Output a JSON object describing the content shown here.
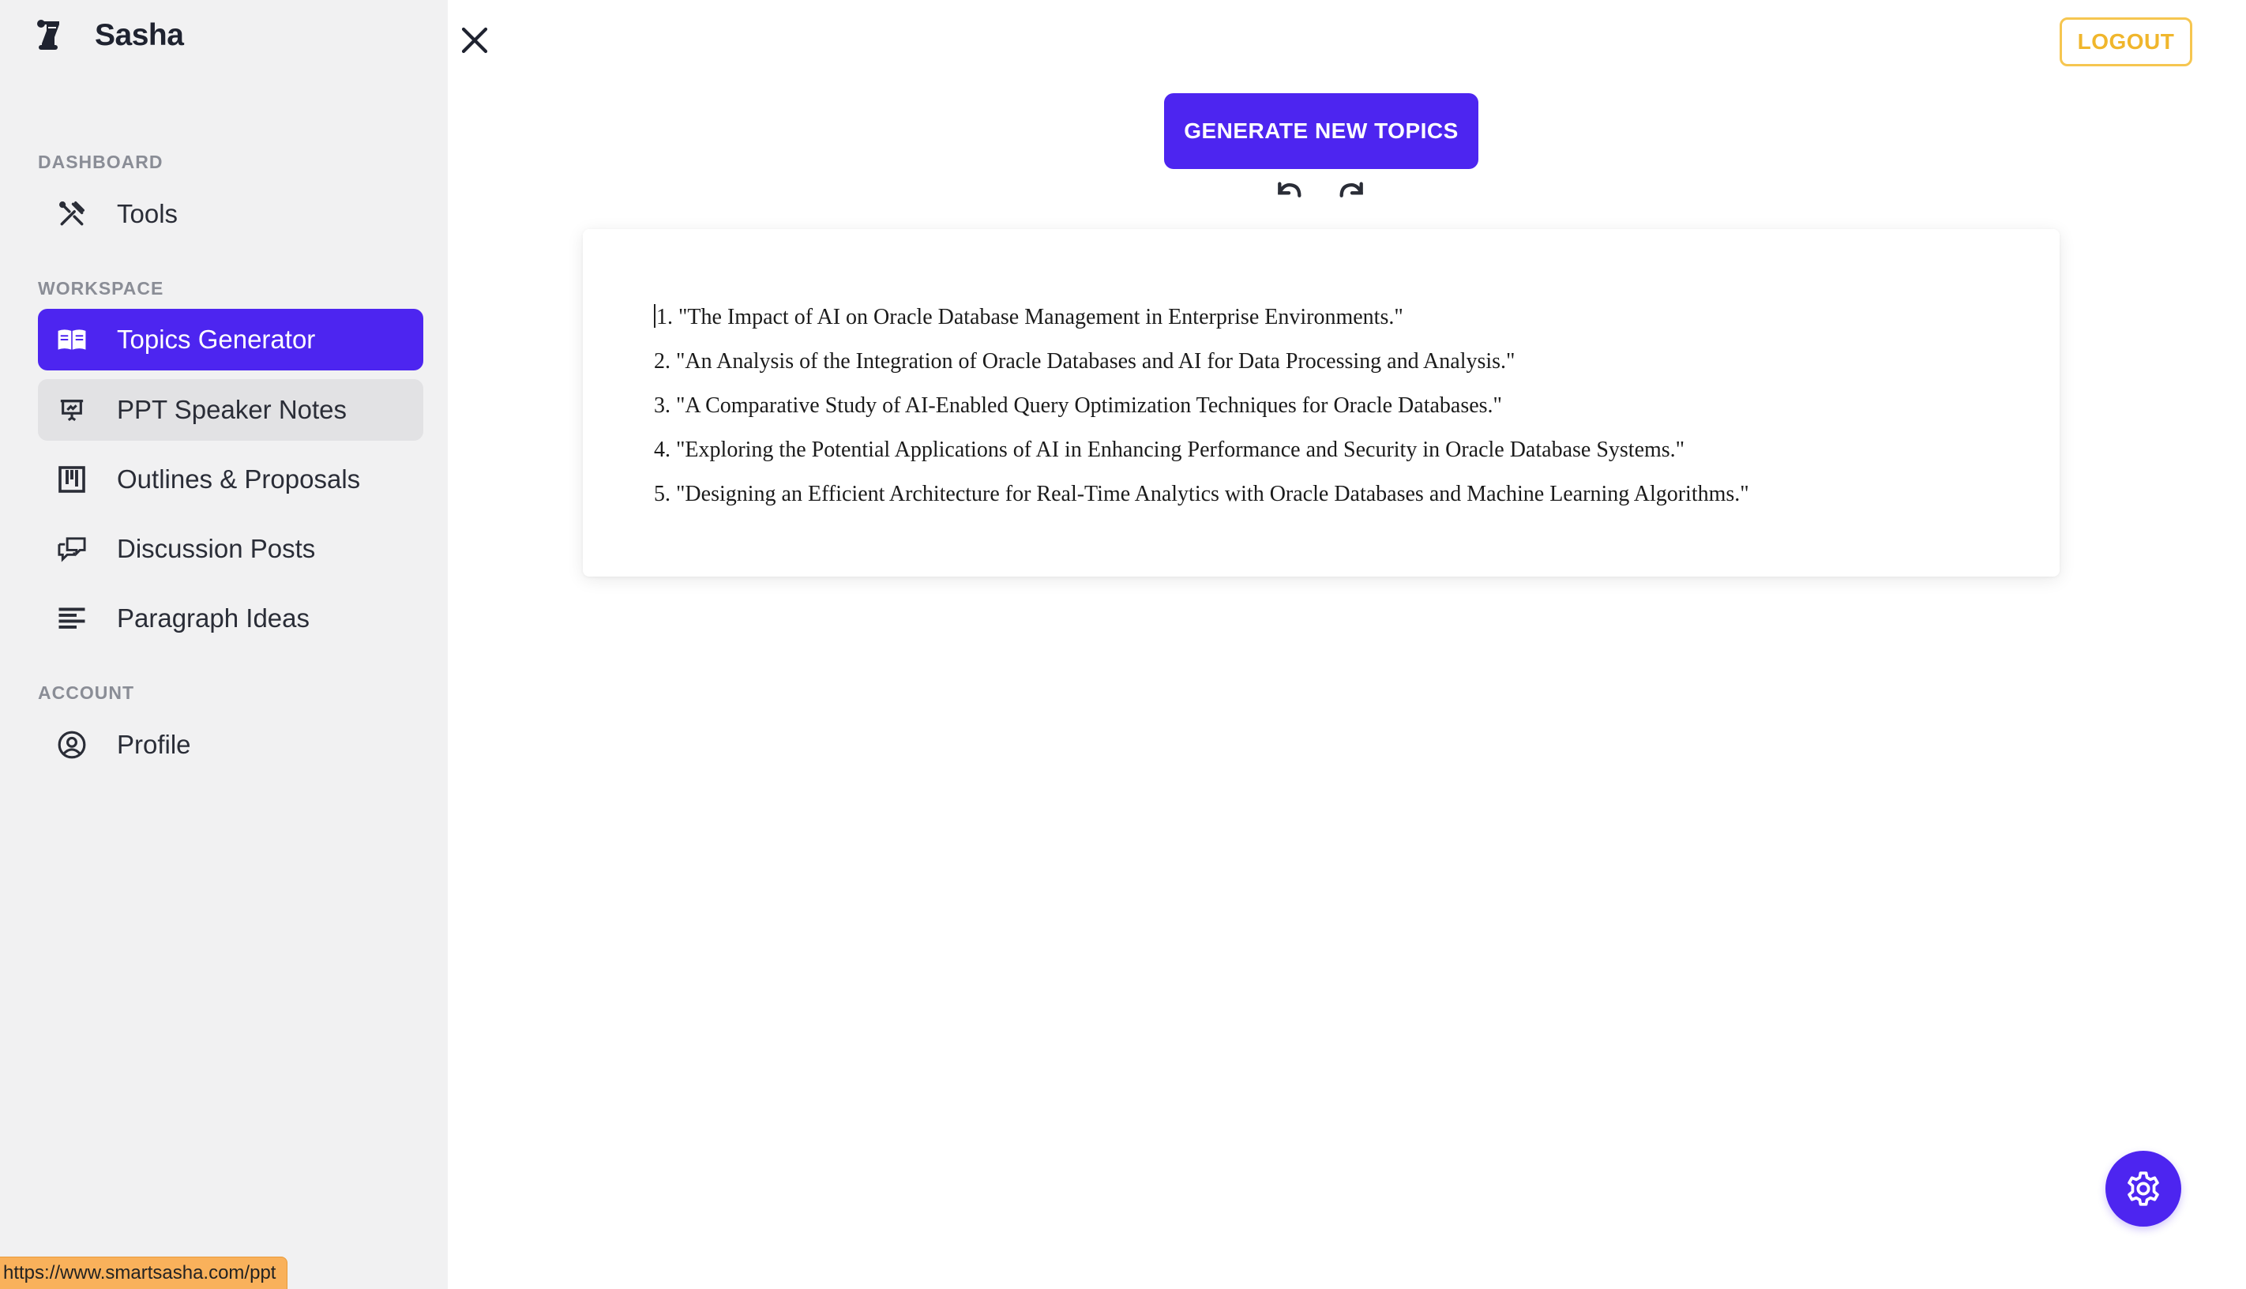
{
  "app": {
    "brand_name": "Sasha"
  },
  "sidebar": {
    "sections": {
      "dashboard": "DASHBOARD",
      "workspace": "WORKSPACE",
      "account": "ACCOUNT"
    },
    "items": [
      {
        "label": "Tools",
        "icon": "tools-icon",
        "state": "default"
      },
      {
        "label": "Topics Generator",
        "icon": "open-book-icon",
        "state": "active"
      },
      {
        "label": "PPT Speaker Notes",
        "icon": "presentation-icon",
        "state": "hover"
      },
      {
        "label": "Outlines & Proposals",
        "icon": "kanban-columns-icon",
        "state": "default"
      },
      {
        "label": "Discussion Posts",
        "icon": "chat-bubbles-icon",
        "state": "default"
      },
      {
        "label": "Paragraph Ideas",
        "icon": "align-left-icon",
        "state": "default"
      },
      {
        "label": "Profile",
        "icon": "user-circle-icon",
        "state": "default"
      }
    ]
  },
  "header": {
    "logout_label": "LOGOUT"
  },
  "main": {
    "generate_label": "GENERATE NEW TOPICS",
    "topics": [
      "1. \"The Impact of AI on Oracle Database Management in Enterprise Environments.\"",
      "2. \"An Analysis of the Integration of Oracle Databases and AI for Data Processing and Analysis.\"",
      "3. \"A Comparative Study of AI-Enabled Query Optimization Techniques for Oracle Databases.\"",
      "4. \"Exploring the Potential Applications of AI in Enhancing Performance and Security in Oracle Database Systems.\"",
      "5. \"Designing an Efficient Architecture for Real-Time Analytics with Oracle Databases and Machine Learning Algorithms.\""
    ]
  },
  "status_bar": {
    "url": "https://www.smartsasha.com/ppt"
  },
  "colors": {
    "accent": "#4d25f0",
    "logout": "#f0b62c",
    "sidebar_bg": "#f1f1f2",
    "status_bg": "#f9b15b"
  }
}
